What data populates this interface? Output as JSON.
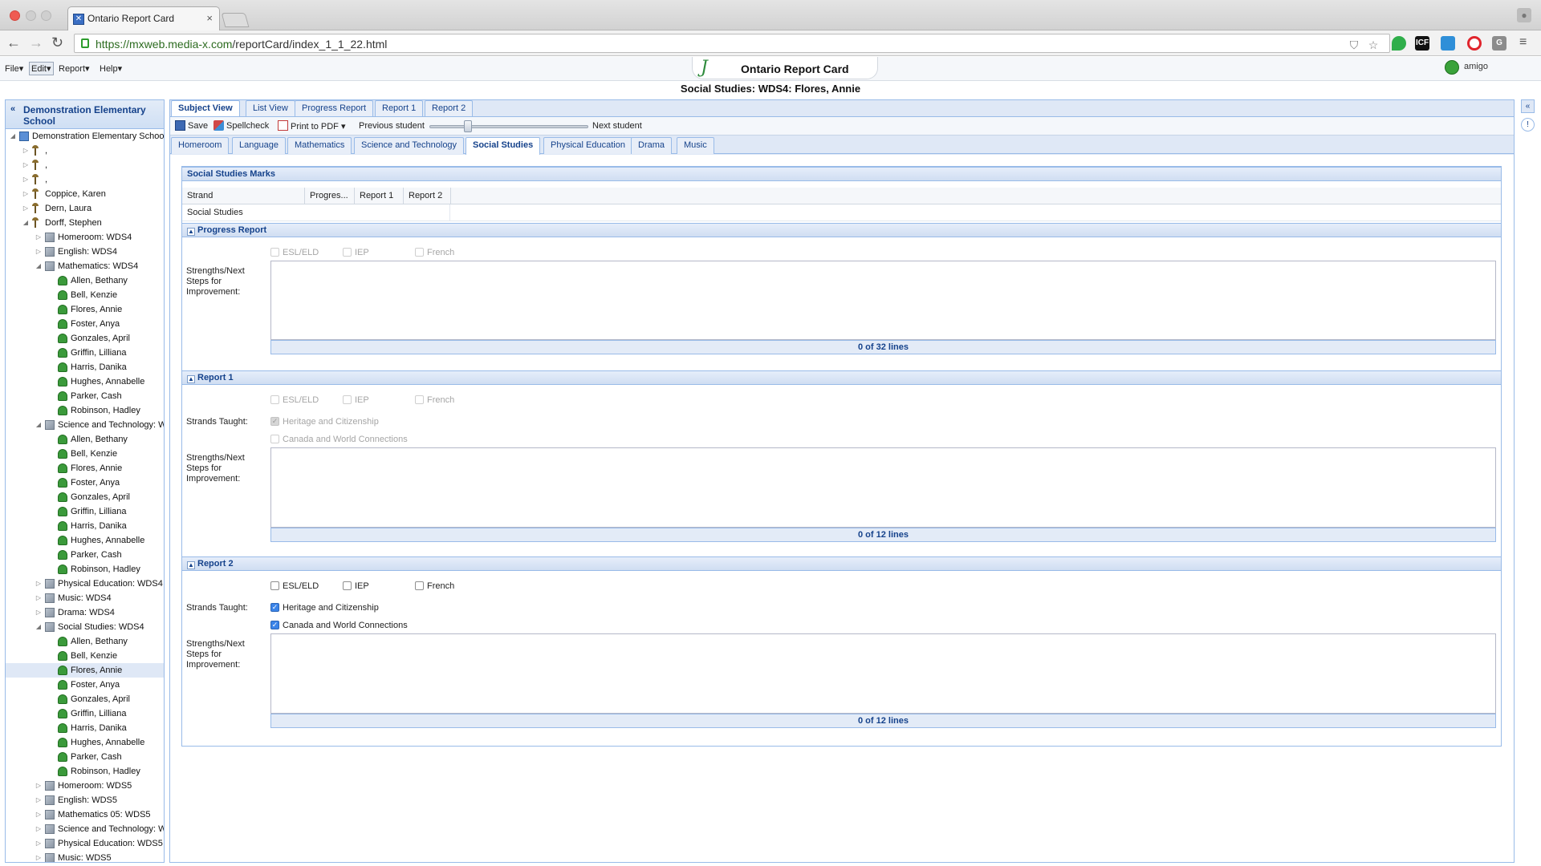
{
  "browser": {
    "tab_title": "Ontario Report Card",
    "url_scheme_host": "https://mxweb.media-x.com",
    "url_path": "/reportCard/index_1_1_22.html",
    "ext_icf": "ICF"
  },
  "app": {
    "menus": [
      "File",
      "Edit",
      "Report",
      "Help"
    ],
    "title": "Ontario Report Card",
    "user": "amigo",
    "heading": "Social Studies: WDS4: Flores, Annie"
  },
  "sidebar": {
    "title": "Demonstration Elementary School",
    "tree": [
      {
        "label": "Demonstration Elementary School",
        "level": 0,
        "icon": "school-icon",
        "exp": "open"
      },
      {
        "label": ",",
        "level": 1,
        "icon": "teacher-icon",
        "exp": "closed"
      },
      {
        "label": ",",
        "level": 1,
        "icon": "teacher-icon",
        "exp": "closed"
      },
      {
        "label": ",",
        "level": 1,
        "icon": "teacher-icon",
        "exp": "closed"
      },
      {
        "label": "Coppice, Karen",
        "level": 1,
        "icon": "teacher-icon",
        "exp": "closed"
      },
      {
        "label": "Dern, Laura",
        "level": 1,
        "icon": "teacher-icon",
        "exp": "closed"
      },
      {
        "label": "Dorff, Stephen",
        "level": 1,
        "icon": "teacher-icon",
        "exp": "open"
      },
      {
        "label": "Homeroom: WDS4",
        "level": 2,
        "icon": "class-icon",
        "exp": "closed"
      },
      {
        "label": "English: WDS4",
        "level": 2,
        "icon": "class-icon",
        "exp": "closed"
      },
      {
        "label": "Mathematics: WDS4",
        "level": 2,
        "icon": "class-icon",
        "exp": "open"
      },
      {
        "label": "Allen, Bethany",
        "level": 3,
        "icon": "student-icon"
      },
      {
        "label": "Bell, Kenzie",
        "level": 3,
        "icon": "student-icon"
      },
      {
        "label": "Flores, Annie",
        "level": 3,
        "icon": "student-icon"
      },
      {
        "label": "Foster, Anya",
        "level": 3,
        "icon": "student-icon"
      },
      {
        "label": "Gonzales, April",
        "level": 3,
        "icon": "student-icon"
      },
      {
        "label": "Griffin, Lilliana",
        "level": 3,
        "icon": "student-icon"
      },
      {
        "label": "Harris, Danika",
        "level": 3,
        "icon": "student-icon"
      },
      {
        "label": "Hughes, Annabelle",
        "level": 3,
        "icon": "student-icon"
      },
      {
        "label": "Parker, Cash",
        "level": 3,
        "icon": "student-icon"
      },
      {
        "label": "Robinson, Hadley",
        "level": 3,
        "icon": "student-icon"
      },
      {
        "label": "Science and Technology: W",
        "level": 2,
        "icon": "class-icon",
        "exp": "open"
      },
      {
        "label": "Allen, Bethany",
        "level": 3,
        "icon": "student-icon"
      },
      {
        "label": "Bell, Kenzie",
        "level": 3,
        "icon": "student-icon"
      },
      {
        "label": "Flores, Annie",
        "level": 3,
        "icon": "student-icon"
      },
      {
        "label": "Foster, Anya",
        "level": 3,
        "icon": "student-icon"
      },
      {
        "label": "Gonzales, April",
        "level": 3,
        "icon": "student-icon"
      },
      {
        "label": "Griffin, Lilliana",
        "level": 3,
        "icon": "student-icon"
      },
      {
        "label": "Harris, Danika",
        "level": 3,
        "icon": "student-icon"
      },
      {
        "label": "Hughes, Annabelle",
        "level": 3,
        "icon": "student-icon"
      },
      {
        "label": "Parker, Cash",
        "level": 3,
        "icon": "student-icon"
      },
      {
        "label": "Robinson, Hadley",
        "level": 3,
        "icon": "student-icon"
      },
      {
        "label": "Physical Education: WDS4",
        "level": 2,
        "icon": "class-icon",
        "exp": "closed"
      },
      {
        "label": "Music: WDS4",
        "level": 2,
        "icon": "class-icon",
        "exp": "closed"
      },
      {
        "label": "Drama: WDS4",
        "level": 2,
        "icon": "class-icon",
        "exp": "closed"
      },
      {
        "label": "Social Studies: WDS4",
        "level": 2,
        "icon": "class-icon",
        "exp": "open"
      },
      {
        "label": "Allen, Bethany",
        "level": 3,
        "icon": "student-icon"
      },
      {
        "label": "Bell, Kenzie",
        "level": 3,
        "icon": "student-icon"
      },
      {
        "label": "Flores, Annie",
        "level": 3,
        "icon": "student-icon",
        "selected": true
      },
      {
        "label": "Foster, Anya",
        "level": 3,
        "icon": "student-icon"
      },
      {
        "label": "Gonzales, April",
        "level": 3,
        "icon": "student-icon"
      },
      {
        "label": "Griffin, Lilliana",
        "level": 3,
        "icon": "student-icon"
      },
      {
        "label": "Harris, Danika",
        "level": 3,
        "icon": "student-icon"
      },
      {
        "label": "Hughes, Annabelle",
        "level": 3,
        "icon": "student-icon"
      },
      {
        "label": "Parker, Cash",
        "level": 3,
        "icon": "student-icon"
      },
      {
        "label": "Robinson, Hadley",
        "level": 3,
        "icon": "student-icon"
      },
      {
        "label": "Homeroom: WDS5",
        "level": 2,
        "icon": "class-icon",
        "exp": "closed"
      },
      {
        "label": "English: WDS5",
        "level": 2,
        "icon": "class-icon",
        "exp": "closed"
      },
      {
        "label": "Mathematics 05: WDS5",
        "level": 2,
        "icon": "class-icon",
        "exp": "closed"
      },
      {
        "label": "Science and Technology: W",
        "level": 2,
        "icon": "class-icon",
        "exp": "closed"
      },
      {
        "label": "Physical Education: WDS5",
        "level": 2,
        "icon": "class-icon",
        "exp": "closed"
      },
      {
        "label": "Music: WDS5",
        "level": 2,
        "icon": "class-icon",
        "exp": "closed"
      }
    ]
  },
  "tabs": [
    "Subject View",
    "List View",
    "Progress Report",
    "Report 1",
    "Report 2"
  ],
  "actions": {
    "save": "Save",
    "spellcheck": "Spellcheck",
    "print": "Print to PDF",
    "prev": "Previous student",
    "next": "Next student",
    "slider_fraction": 0.23
  },
  "subject_tabs": [
    "Homeroom",
    "Language",
    "Mathematics",
    "Science and Technology",
    "Social Studies",
    "Physical Education",
    "Drama",
    "Music"
  ],
  "marks": {
    "title": "Social Studies Marks",
    "columns": [
      "Strand",
      "Progres...",
      "Report 1",
      "Report 2"
    ],
    "row": "Social Studies"
  },
  "labels": {
    "strengths": "Strengths/Next Steps for Improvement:",
    "strands_taught": "Strands Taught:",
    "esl": "ESL/ELD",
    "iep": "IEP",
    "french": "French",
    "heritage": "Heritage and Citizenship",
    "canada": "Canada and World Connections"
  },
  "progress": {
    "title": "Progress Report",
    "lines": "0 of 32 lines"
  },
  "report1": {
    "title": "Report 1",
    "lines": "0 of 12 lines"
  },
  "report2": {
    "title": "Report 2",
    "lines": "0 of 12 lines"
  }
}
